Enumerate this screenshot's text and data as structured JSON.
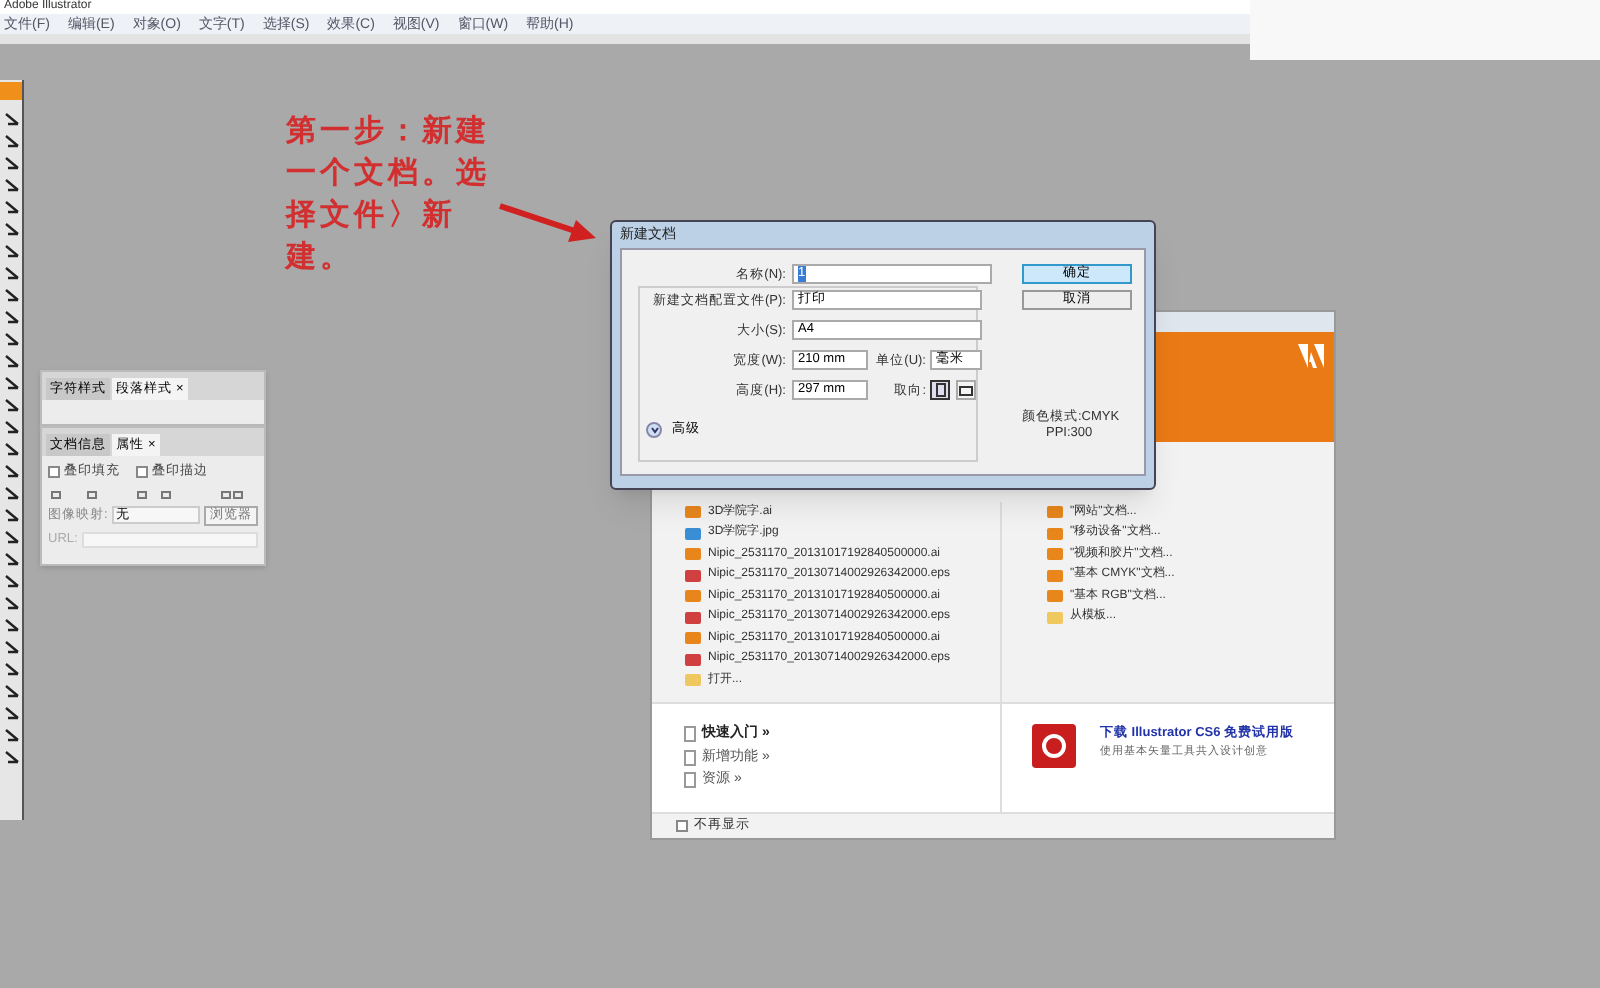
{
  "window": {
    "title": "Adobe Illustrator"
  },
  "menu": [
    "文件(F)",
    "编辑(E)",
    "对象(O)",
    "文字(T)",
    "选择(S)",
    "效果(C)",
    "视图(V)",
    "窗口(W)",
    "帮助(H)"
  ],
  "annotation": {
    "text": "第一步：新建一个文档。选择文件〉新建。"
  },
  "panels": [
    {
      "tabs": [
        {
          "label": "字符样式",
          "selected": false
        },
        {
          "label": "段落样式",
          "selected": true,
          "close": "×"
        }
      ]
    },
    {
      "tabs": [
        {
          "label": "文档信息",
          "selected": false
        },
        {
          "label": "属性",
          "selected": true,
          "close": "×"
        }
      ],
      "checkboxes": [
        {
          "label": "叠印填充",
          "checked": false
        },
        {
          "label": "叠印描边",
          "checked": false
        }
      ],
      "image_map": {
        "label": "图像映射:",
        "value": "无",
        "button": "浏览器"
      },
      "url": {
        "label": "URL:"
      }
    }
  ],
  "dialog": {
    "title": "新建文档",
    "name": {
      "label": "名称(N):",
      "value": "1"
    },
    "profile": {
      "label": "新建文档配置文件(P):",
      "value": "打印"
    },
    "size": {
      "label": "大小(S):",
      "value": "A4"
    },
    "width": {
      "label": "宽度(W):",
      "value": "210 mm"
    },
    "units": {
      "label": "单位(U):",
      "value": "毫米"
    },
    "height": {
      "label": "高度(H):",
      "value": "297 mm"
    },
    "orientation": {
      "label": "取向:",
      "options": [
        {
          "kind": "portrait",
          "selected": true
        },
        {
          "kind": "landscape",
          "selected": false
        }
      ]
    },
    "advanced": {
      "label": "高级",
      "expanded": false
    },
    "buttons": [
      "确定",
      "取消"
    ],
    "color_mode": "颜色模式:CMYK",
    "ppi": "PPI:300"
  },
  "welcome": {
    "recent": [
      {
        "kind": "ai",
        "label": "3D学院字.ai"
      },
      {
        "kind": "jpg",
        "label": "3D学院字.jpg"
      },
      {
        "kind": "ai",
        "label": "Nipic_2531170_20131017192840500000.ai"
      },
      {
        "kind": "eps",
        "label": "Nipic_2531170_20130714002926342000.eps"
      },
      {
        "kind": "ai",
        "label": "Nipic_2531170_20131017192840500000.ai"
      },
      {
        "kind": "eps",
        "label": "Nipic_2531170_20130714002926342000.eps"
      },
      {
        "kind": "ai",
        "label": "Nipic_2531170_20131017192840500000.ai"
      },
      {
        "kind": "eps",
        "label": "Nipic_2531170_20130714002926342000.eps"
      },
      {
        "kind": "folder",
        "label": "打开..."
      }
    ],
    "new": [
      {
        "kind": "ai",
        "label": "\"网站\"文档..."
      },
      {
        "kind": "ai",
        "label": "\"移动设备\"文档..."
      },
      {
        "kind": "ai",
        "label": "\"视频和胶片\"文档..."
      },
      {
        "kind": "ai",
        "label": "\"基本 CMYK\"文档..."
      },
      {
        "kind": "ai",
        "label": "\"基本 RGB\"文档..."
      },
      {
        "kind": "folder",
        "label": "从模板..."
      }
    ],
    "links": [
      "快速入门 »",
      "新增功能 »",
      "资源 »"
    ],
    "promo": {
      "title": "下载 Illustrator CS6 免费试用版",
      "text": "使用基本矢量工具共入设计创意"
    },
    "dont_show": {
      "label": "不再显示",
      "checked": false
    }
  }
}
